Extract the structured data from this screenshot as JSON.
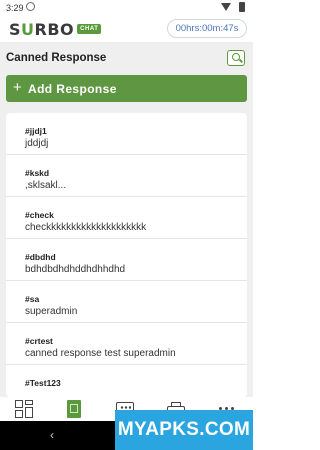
{
  "status_bar": {
    "time": "3:29"
  },
  "header": {
    "logo_prefix": "S",
    "logo_o": "U",
    "logo_suffix": "RBO",
    "logo_badge": "CHAT",
    "timer": "00hrs:00m:47s"
  },
  "page": {
    "title": "Canned Response",
    "add_button": {
      "icon": "+",
      "label": "Add Response"
    }
  },
  "responses": [
    {
      "shortcut": "#jjdj1",
      "text": "jddjdj"
    },
    {
      "shortcut": "#kskd",
      "text": ",sklsakl..."
    },
    {
      "shortcut": "#check",
      "text": "checkkkkkkkkkkkkkkkkkkkk"
    },
    {
      "shortcut": "#dbdhd",
      "text": "bdhdbdhdhddhdhhdhd"
    },
    {
      "shortcut": "#sa",
      "text": "superadmin"
    },
    {
      "shortcut": "#crtest",
      "text": "canned response test superadmin"
    },
    {
      "shortcut": "#Test123",
      "text": ""
    }
  ],
  "bottom_nav": {
    "items": [
      "dashboard-icon",
      "canned-response-icon",
      "chat-icon",
      "print-icon",
      "more-icon"
    ],
    "active": "canned-response-icon",
    "accent": "#5a9a3c"
  },
  "system_nav": {
    "back": "‹"
  },
  "watermark": "MYAPKS.COM",
  "colors": {
    "brand_green": "#5e9641",
    "timer_blue": "#4a78b8",
    "background": "#efefef"
  }
}
